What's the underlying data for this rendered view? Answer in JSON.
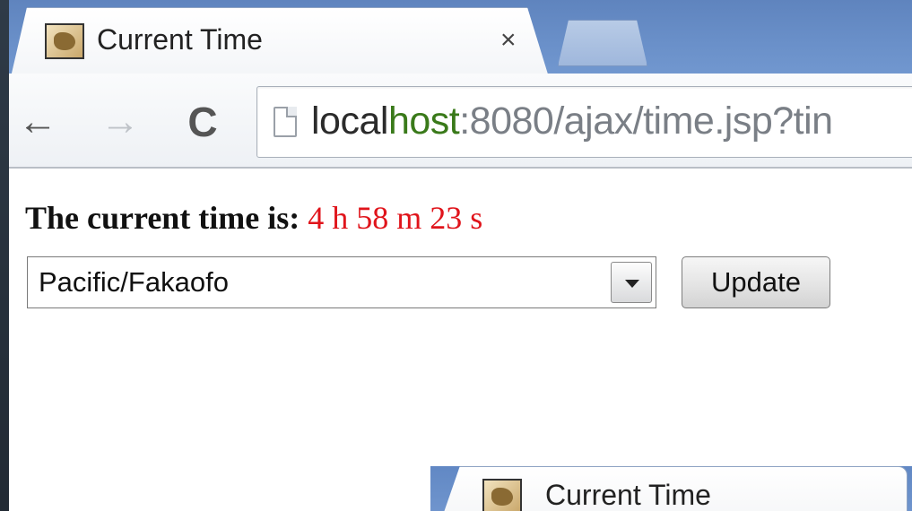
{
  "window": {
    "tab_title": "Current Time",
    "tab_close": "×",
    "nav": {
      "back": "←",
      "forward": "→",
      "reload": "C"
    },
    "address": {
      "host_prefix": "local",
      "host_green": "host",
      "rest": ":8080/ajax/time.jsp?tin"
    }
  },
  "page": {
    "time_label": "The current time is:",
    "time_value": "4 h 58 m 23 s",
    "timezone_selected": "Pacific/Fakaofo",
    "update_button": "Update"
  },
  "second_window": {
    "tab_title": "Current Time"
  },
  "colors": {
    "time_value": "#e0141b",
    "url_host_green": "#3a7a1a",
    "tabstrip": "#6a90c9"
  }
}
